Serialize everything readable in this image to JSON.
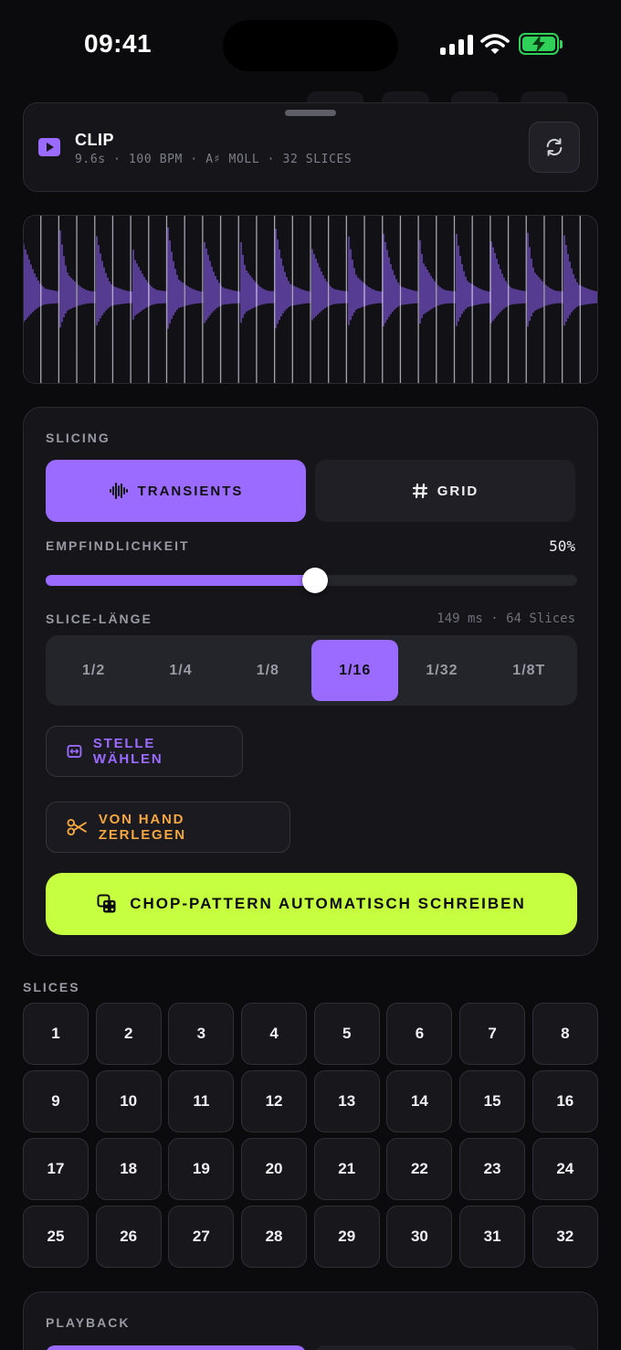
{
  "status_bar": {
    "time": "09:41"
  },
  "clip": {
    "title": "CLIP",
    "meta": "9.6s · 100 BPM · A♯ MOLL · 32 SLICES"
  },
  "slicing": {
    "section_label": "SLICING",
    "modes": {
      "transients": "TRANSIENTS",
      "grid": "GRID",
      "selected": "TRANSIENTS"
    },
    "sensitivity": {
      "label": "EMPFINDLICHKEIT",
      "value_text": "50%",
      "value": 0.5
    },
    "slice_length": {
      "label": "SLICE-LÄNGE",
      "info": "149 ms · 64 Slices",
      "options": [
        "1/2",
        "1/4",
        "1/8",
        "1/16",
        "1/32",
        "1/8T"
      ],
      "selected": "1/16"
    },
    "pick_button": "STELLE WÄHLEN",
    "manual_button": "VON HAND ZERLEGEN",
    "auto_button": "CHOP-PATTERN AUTOMATISCH SCHREIBEN"
  },
  "slices": {
    "label": "SLICES",
    "pads": [
      "1",
      "2",
      "3",
      "4",
      "5",
      "6",
      "7",
      "8",
      "9",
      "10",
      "11",
      "12",
      "13",
      "14",
      "15",
      "16",
      "17",
      "18",
      "19",
      "20",
      "21",
      "22",
      "23",
      "24",
      "25",
      "26",
      "27",
      "28",
      "29",
      "30",
      "31",
      "32"
    ]
  },
  "playback": {
    "label": "PLAYBACK"
  },
  "colors": {
    "accent": "#9b6bff",
    "cta": "#c6ff3f",
    "warning": "#f4a640",
    "background": "#0b0b0e"
  }
}
